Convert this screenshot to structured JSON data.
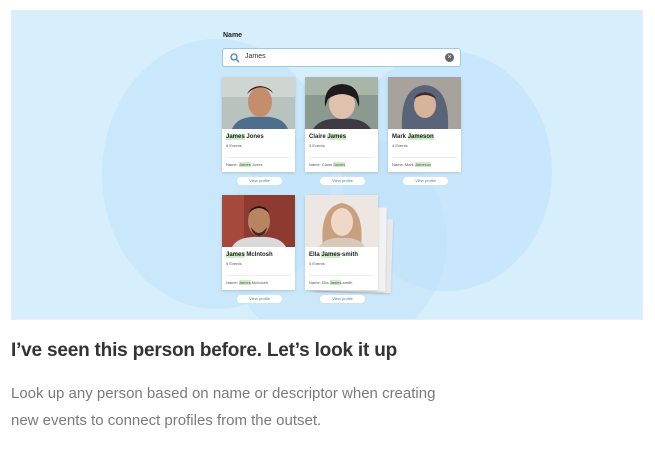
{
  "search": {
    "label": "Name",
    "value": "James",
    "icon": "search-icon",
    "clear_icon": "clear-icon"
  },
  "profiles": [
    {
      "name_pre": "",
      "name_hl": "James",
      "name_post": " Jones",
      "events": "6 Events",
      "detail_pre": "Name: ",
      "detail_hl": "James",
      "detail_post": " Jones",
      "button": "View profile"
    },
    {
      "name_pre": "Claire ",
      "name_hl": "James",
      "name_post": "",
      "events": "3 Events",
      "detail_pre": "Name: Claire ",
      "detail_hl": "James",
      "detail_post": "",
      "button": "View profile"
    },
    {
      "name_pre": "Mark ",
      "name_hl": "Jameson",
      "name_post": "",
      "events": "4 Events",
      "detail_pre": "Name: Mark ",
      "detail_hl": "Jameson",
      "detail_post": "",
      "button": "View profile"
    },
    {
      "name_pre": "",
      "name_hl": "James",
      "name_post": " McIntosh",
      "events": "5 Events",
      "detail_pre": "Name: ",
      "detail_hl": "James",
      "detail_post": " McIntosh",
      "button": "View profile"
    },
    {
      "name_pre": "Ella ",
      "name_hl": "James",
      "name_post": "-smith",
      "events": "4 Events",
      "detail_pre": "Name: Ella ",
      "detail_hl": "James",
      "detail_post": "-smith",
      "button": "View profile"
    }
  ],
  "colors": {
    "highlight": "#cdeec7",
    "hero_background": "#d7eefc",
    "accent": "#4a7fb0"
  },
  "heading": "I’ve seen this person before. Let’s look it up",
  "description": {
    "line1": "Look up any person based on name or descriptor when creating",
    "line2": "new events to connect profiles from the outset."
  }
}
